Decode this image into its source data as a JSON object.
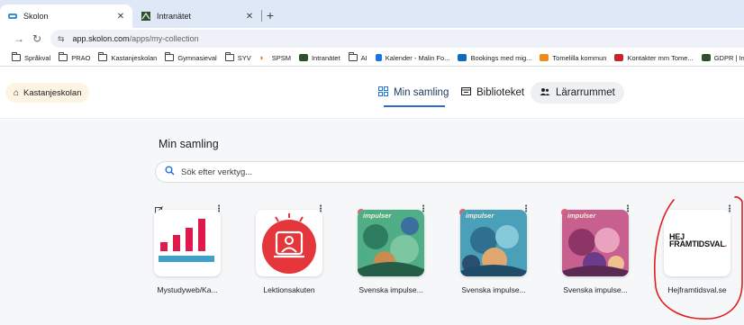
{
  "browser": {
    "tabs": [
      {
        "title": "Skolon",
        "active": true
      },
      {
        "title": "Intranätet",
        "active": false
      }
    ],
    "url_host": "app.skolon.com",
    "url_path": "/apps/my-collection",
    "bookmarks": [
      {
        "label": "Språkval",
        "icon": "folder-icon"
      },
      {
        "label": "PRAO",
        "icon": "folder-icon"
      },
      {
        "label": "Kastanjeskolan",
        "icon": "folder-icon"
      },
      {
        "label": "Gymnasieval",
        "icon": "folder-icon"
      },
      {
        "label": "SYV",
        "icon": "folder-icon"
      },
      {
        "label": "SPSM",
        "icon": "spsm-icon"
      },
      {
        "label": "Intranätet",
        "icon": "intranet-icon"
      },
      {
        "label": "AI",
        "icon": "folder-icon"
      },
      {
        "label": "Kalender - Malin Fo...",
        "icon": "calendar-icon"
      },
      {
        "label": "Bookings med mig...",
        "icon": "outlook-icon"
      },
      {
        "label": "Tomelilla kommun",
        "icon": "tomelilla-icon"
      },
      {
        "label": "Kontakter mm Tome...",
        "icon": "office-icon"
      },
      {
        "label": "GDPR | Intran",
        "icon": "intranet-icon"
      }
    ]
  },
  "header": {
    "school": "Kastanjeskolan",
    "nav": {
      "collection": "Min samling",
      "library": "Biblioteket",
      "teacher_room": "Lärarrummet"
    }
  },
  "main": {
    "title": "Min samling",
    "search_placeholder": "Sök efter verktyg...",
    "apps": [
      {
        "label": "Mystudyweb/Ka..."
      },
      {
        "label": "Lektionsakuten"
      },
      {
        "label": "Svenska impulse..."
      },
      {
        "label": "Svenska impulse..."
      },
      {
        "label": "Svenska impulse..."
      },
      {
        "label": "Hejframtidsval.se"
      }
    ],
    "impulser_word": "impulser",
    "hej_logo": [
      "HEJ",
      "FRAMTIDSVAL",
      "."
    ]
  },
  "colors": {
    "tabstrip": "#dfe8f7",
    "accent": "#1a73e8",
    "lektion_red": "#e5363c",
    "mystudy_red": "#e0194d",
    "mystudy_blue": "#3fa0c8",
    "badge": "#e0626a",
    "annotation_red": "#e01e1e"
  }
}
